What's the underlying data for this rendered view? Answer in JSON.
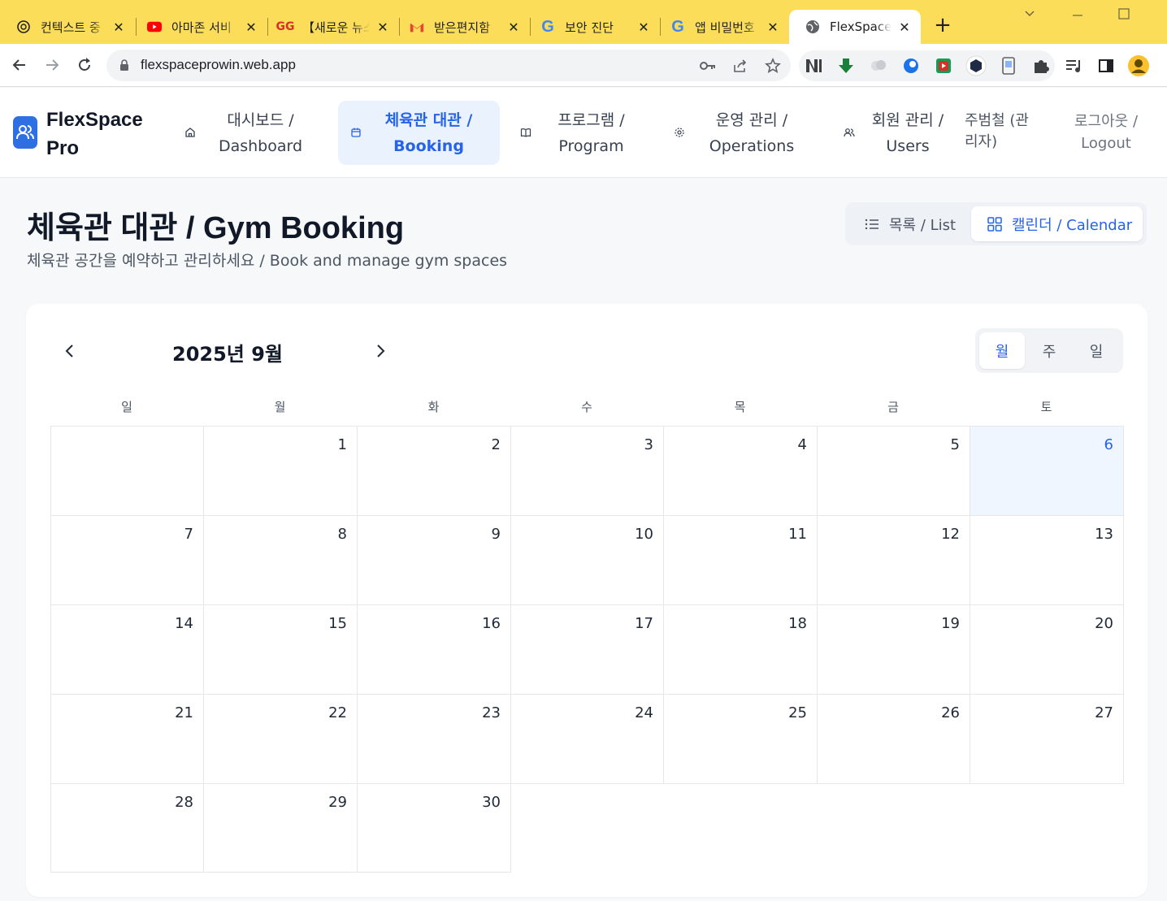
{
  "browser": {
    "tabs": [
      {
        "title": "컨텍스트 중",
        "icon": "openai-icon"
      },
      {
        "title": "아마존 서비",
        "icon": "youtube-icon"
      },
      {
        "title": "【새로운 뉴스",
        "icon": "gg-icon"
      },
      {
        "title": "받은편지함",
        "icon": "gmail-icon"
      },
      {
        "title": "보안 진단",
        "icon": "google-icon"
      },
      {
        "title": "앱 비밀번호",
        "icon": "google-icon"
      },
      {
        "title": "FlexSpace Pro",
        "icon": "globe-icon",
        "active": true
      }
    ],
    "url": "flexspaceprowin.web.app"
  },
  "app": {
    "brand_line1": "FlexSpace",
    "brand_line2": "Pro",
    "accent": "#2563eb",
    "nav": [
      {
        "line1": "대시보드 /",
        "line2": "Dashboard",
        "icon": "home-icon"
      },
      {
        "line1": "체육관 대관 /",
        "line2": "Booking",
        "icon": "calendar-icon",
        "active": true
      },
      {
        "line1": "프로그램 /",
        "line2": "Program",
        "icon": "book-icon"
      },
      {
        "line1": "운영 관리 /",
        "line2": "Operations",
        "icon": "gear-icon"
      },
      {
        "line1": "회원 관리 /",
        "line2": "Users",
        "icon": "users-icon"
      }
    ],
    "user_line1": "주범철 (관",
    "user_line2": "리자)",
    "logout_line1": "로그아웃 /",
    "logout_line2": "Logout"
  },
  "page": {
    "title": "체육관 대관 / Gym Booking",
    "subtitle": "체육관 공간을 예약하고 관리하세요 / Book and manage gym spaces",
    "view_list": "목록 / List",
    "view_calendar": "캘린더 / Calendar"
  },
  "calendar": {
    "month_label": "2025년 9월",
    "modes": [
      "월",
      "주",
      "일"
    ],
    "active_mode": "월",
    "weekdays": [
      "일",
      "월",
      "화",
      "수",
      "목",
      "금",
      "토"
    ],
    "first_weekday_index": 1,
    "days_in_month": 30,
    "today": 6
  }
}
